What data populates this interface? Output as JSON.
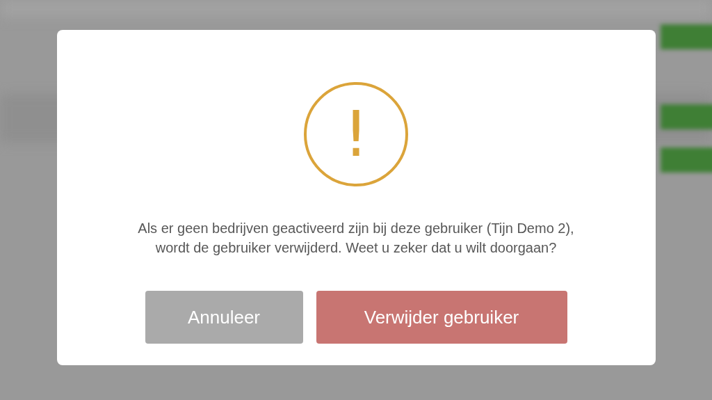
{
  "dialog": {
    "icon_text": "!",
    "message": "Als er geen bedrijven geactiveerd zijn bij deze gebruiker (Tijn Demo 2),\nwordt de gebruiker verwijderd. Weet u zeker dat u wilt doorgaan?",
    "buttons": [
      {
        "label": "Annuleer",
        "kind": "cancel"
      },
      {
        "label": "Verwijder gebruiker",
        "kind": "danger"
      }
    ]
  }
}
